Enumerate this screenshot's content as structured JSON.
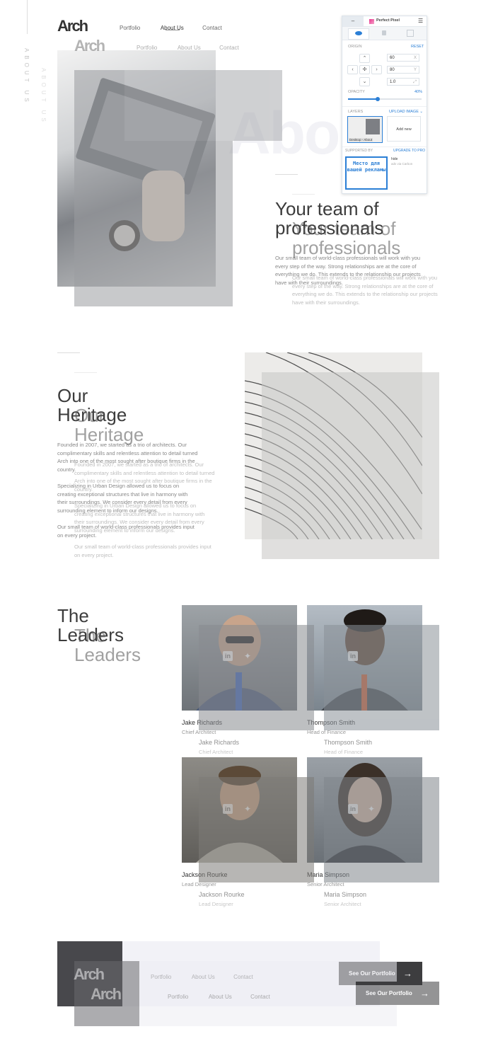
{
  "site": {
    "logo": "Arch",
    "nav": [
      "Portfolio",
      "About Us",
      "Contact"
    ],
    "side_label": "ABOUT US"
  },
  "hero": {
    "big_text": "About",
    "title_line1": "Your team of",
    "title_line2": "professionals",
    "overlay_line2": "professionals",
    "body": "Our small team of world-class professionals will work with you every step of the way. Strong relationships are at the core of everything we do. This extends to the relationship our projects have with their surroundings."
  },
  "heritage": {
    "title_line1": "Our",
    "title_line2": "Heritage",
    "para1": "Founded in 2007, we started as a trio of architects. Our complimentary skills and relentless attention to detail turned Arch into one of the most sought after boutique firms in the country.",
    "para2": "Specializing in Urban Design allowed us to focus on creating exceptional structures that live in harmony with their surroundings. We consider every detail from every surrounding element to inform our designs.",
    "para3": "Our small team of world-class professionals provides input on every project."
  },
  "leaders": {
    "title_line1": "The",
    "title_line2": "Leaders",
    "people": [
      {
        "name": "Jake Richards",
        "role": "Chief Architect"
      },
      {
        "name": "Thompson Smith",
        "role": "Head of Finance"
      },
      {
        "name": "Jackson Rourke",
        "role": "Lead Designer"
      },
      {
        "name": "Maria Simpson",
        "role": "Senior Architect"
      }
    ]
  },
  "footer": {
    "logo": "Arch",
    "nav": [
      "Portfolio",
      "About Us",
      "Contact"
    ],
    "cta": "See Our Portfolio",
    "cta_arrow": "→"
  },
  "perfect_pixel": {
    "collapse": "–",
    "brand": "Perfect Pixel",
    "menu_icon": "☰",
    "origin_label": "ORIGIN",
    "reset_label": "RESET",
    "x_value": "60",
    "x_unit": "X",
    "y_value": "80",
    "y_unit": "Y",
    "scale_value": "1.0",
    "opacity_label": "OPACITY",
    "opacity_value": "40%",
    "opacity": 0.4,
    "layers_label": "LAYERS",
    "upload_label": "UPLOAD IMAGE",
    "layer_thumb_label": "Desktop - About",
    "add_new_label": "Add new",
    "supported_by_label": "SUPPORTED BY",
    "upgrade_label": "UPGRADE TO PRO",
    "ad_text": "Место для вашей рекламы",
    "hide_label": "hide",
    "ads_via": "ads via Carbon"
  },
  "colors": {
    "accent": "#2b7fd6",
    "dark_button": "#3d3d3f",
    "text_dark": "#3c3c3c",
    "text_muted": "#888888"
  }
}
